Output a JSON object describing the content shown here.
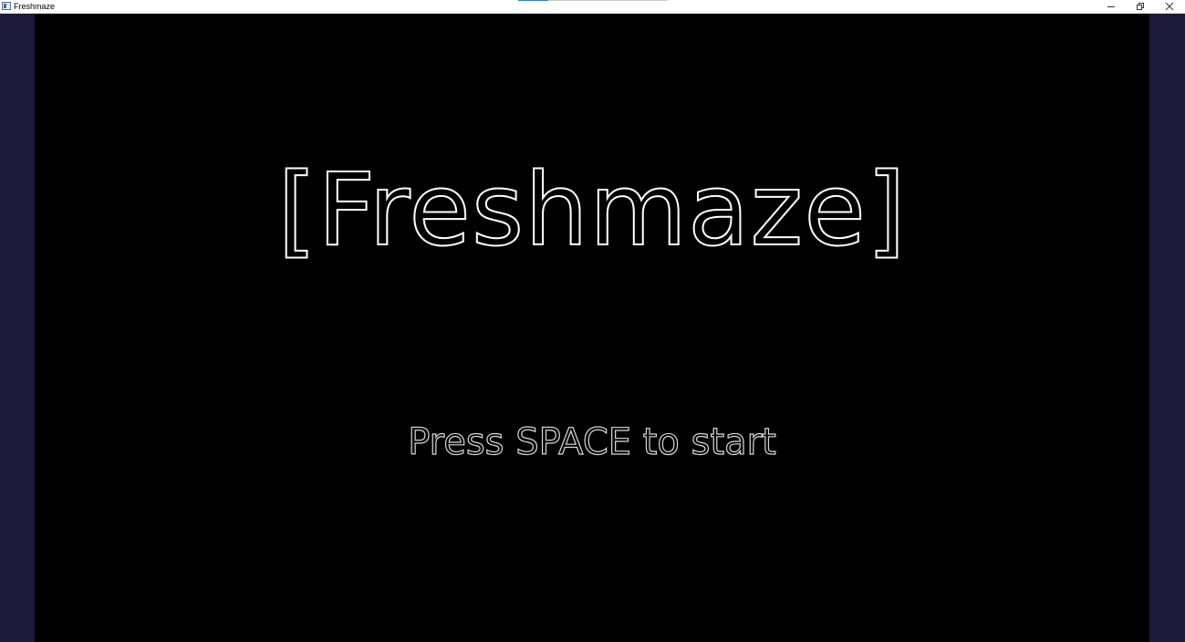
{
  "window": {
    "title": "Freshmaze",
    "icon": "app-window-icon",
    "controls": {
      "minimize_icon": "minimize-icon",
      "restore_icon": "restore-icon",
      "close_icon": "close-icon"
    }
  },
  "game": {
    "title": "[Freshmaze]",
    "prompt": "Press SPACE to start"
  },
  "colors": {
    "titlebar": "#ffffff",
    "letterbox": "#1b1a3a",
    "viewport": "#000000",
    "title_outline": "#ffffff",
    "prompt_outline": "#d8d8d8"
  }
}
